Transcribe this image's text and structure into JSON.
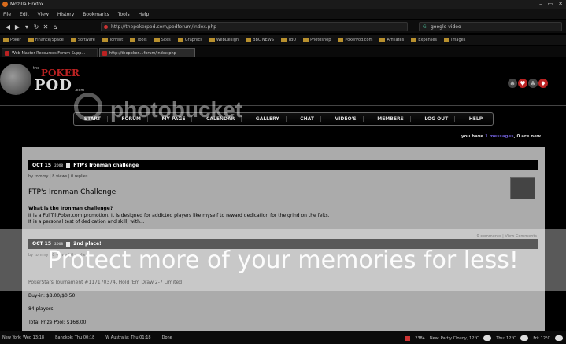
{
  "window": {
    "title": "Mozilla Firefox",
    "controls": [
      "–",
      "▭",
      "✕"
    ]
  },
  "menu": [
    "File",
    "Edit",
    "View",
    "History",
    "Bookmarks",
    "Tools",
    "Help"
  ],
  "url": "http://thepokerpod.com/podforum/index.php",
  "search": {
    "engine": "G",
    "value": "google video"
  },
  "bookmarks": [
    "Poker",
    "Finance/Space",
    "Software",
    "Torrent",
    "Tools",
    "Sites",
    "Graphics",
    "WebDesign",
    "BBC NEWS",
    "TBU",
    "Photoshop",
    "PokerPod.com",
    "Affiliates",
    "Expenses",
    "Images"
  ],
  "tabs": [
    {
      "label": "Web Master Resources Forum Supp..."
    },
    {
      "label": "http://thepoker....forum/index.php"
    }
  ],
  "banner": {
    "logo_the": "the",
    "logo_poker": "POKER",
    "logo_pod": "POD",
    "logo_com": ".com"
  },
  "site_nav": [
    "START",
    "FORUM",
    "MY PAGE",
    "CALENDAR",
    "GALLERY",
    "CHAT",
    "VIDEO'S",
    "MEMBERS",
    "LOG OUT",
    "HELP"
  ],
  "user_line": {
    "before": "you have ",
    "link": "1 messages",
    "after": ", 0 are new."
  },
  "post1": {
    "date": "OCT 15",
    "time": "2008",
    "bar_title": "FTP's Ironman challenge",
    "meta": "by tommy | 8 views | 0 replies",
    "title": "FTP's Ironman Challenge",
    "subtitle": "What is the Ironman challenge?",
    "lines": [
      "It is a FullTiltPoker.com promotion. It is designed for addicted players like myself to reward dedication for the grind on the felts.",
      "It is a personal test of dedication and skill, with..."
    ],
    "comments": "0 comments | View Comments"
  },
  "post2": {
    "date": "OCT 15",
    "time": "2008",
    "bar_title": "2nd place!",
    "meta": "by tommy | 8 views | 0 replies",
    "line1": "PokerStars Tournament #117170374, Hold 'Em Draw 2-7 Limited",
    "line2": "Buy-in: $8.00/$0.50",
    "line3": "84 players",
    "line4": "Total Prize Pool: $168.00"
  },
  "statusbar": [
    "New York: Wed 13:18",
    "Bangkok: Thu 00:18",
    "W Australia: Thu 01:18",
    "Done"
  ],
  "status_right": {
    "count": "2384",
    "weather1": "New: Partly Cloudy, 12°C",
    "weather2": "Thu: 12°C",
    "weather3": "Fri: 12°C"
  },
  "watermark": {
    "brand": "photobucket",
    "text": "Protect more of your memories for less!"
  }
}
